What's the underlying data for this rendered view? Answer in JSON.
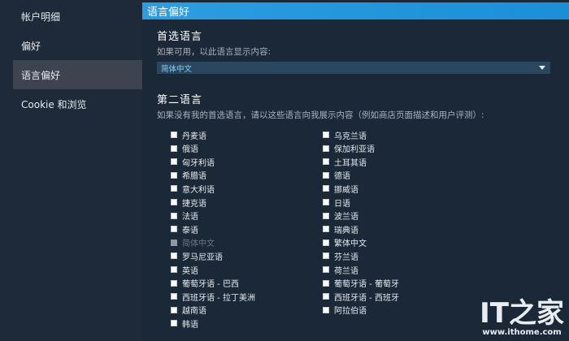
{
  "sidebar": {
    "items": [
      {
        "label": "帐户明细",
        "active": false
      },
      {
        "label": "偏好",
        "active": false
      },
      {
        "label": "语言偏好",
        "active": true
      },
      {
        "label": "Cookie 和浏览",
        "active": false
      }
    ]
  },
  "header": {
    "title": "语言偏好"
  },
  "primary": {
    "title": "首选语言",
    "desc": "如果可用，以此语言显示内容:",
    "selected": "简体中文"
  },
  "secondary": {
    "title": "第二语言",
    "desc": "如果没有我的首选语言，请以这些语言向我展示内容（例如商店页面描述和用户评测）:",
    "col1": [
      "丹麦语",
      "俄语",
      "匈牙利语",
      "希腊语",
      "意大利语",
      "捷克语",
      "法语",
      "泰语",
      "简体中文",
      "罗马尼亚语",
      "英语",
      "葡萄牙语 - 巴西",
      "西班牙语 - 拉丁美洲",
      "越南语",
      "韩语"
    ],
    "col2": [
      "乌克兰语",
      "保加利亚语",
      "土耳其语",
      "德语",
      "挪威语",
      "日语",
      "波兰语",
      "瑞典语",
      "繁体中文",
      "芬兰语",
      "荷兰语",
      "葡萄牙语 - 葡萄牙",
      "西班牙语 - 西班牙",
      "阿拉伯语"
    ],
    "disabled": "简体中文"
  },
  "watermark": {
    "logo": "IT之家",
    "url": "www.ithome.com"
  }
}
